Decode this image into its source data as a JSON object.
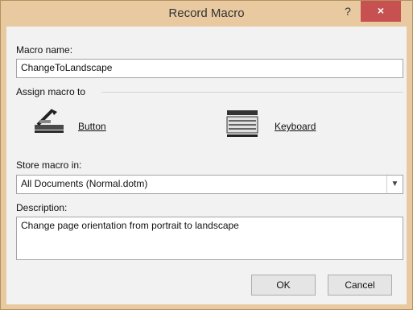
{
  "window": {
    "title": "Record Macro",
    "help_label": "?",
    "close_label": "×"
  },
  "macro_name": {
    "label": "Macro name:",
    "value": "ChangeToLandscape"
  },
  "assign": {
    "label": "Assign macro to",
    "button_label": "Button",
    "keyboard_label": "Keyboard"
  },
  "store": {
    "label": "Store macro in:",
    "value": "All Documents (Normal.dotm)"
  },
  "description": {
    "label": "Description:",
    "value": "Change page orientation from portrait to landscape"
  },
  "buttons": {
    "ok_label": "OK",
    "cancel_label": "Cancel"
  },
  "icons": {
    "button": "toolbar-button-icon",
    "keyboard": "keyboard-icon"
  }
}
